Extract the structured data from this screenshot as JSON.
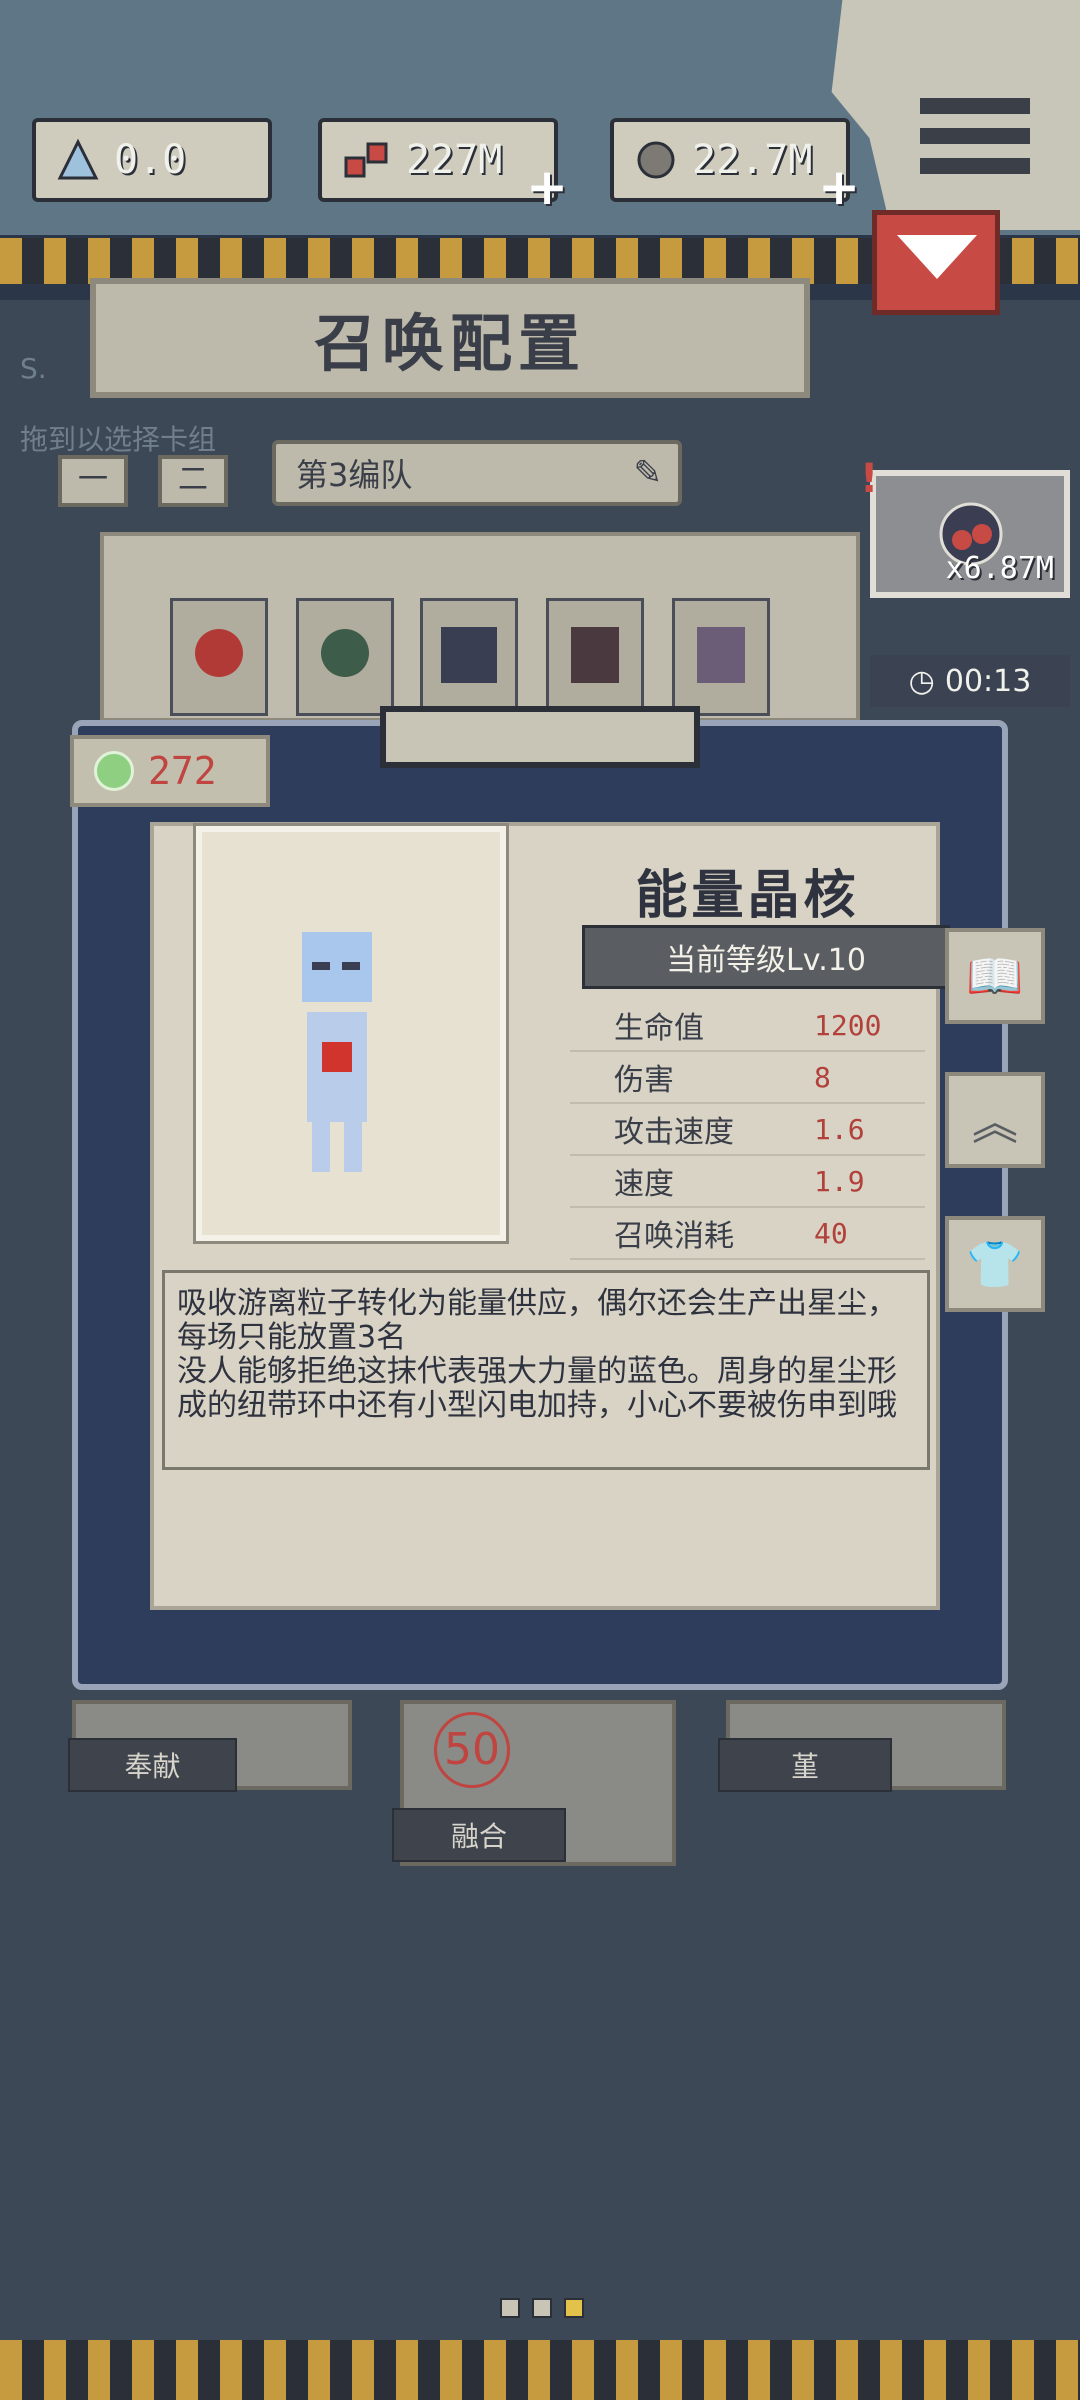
{
  "resources": [
    {
      "icon": "crystal-triangle-icon",
      "value": "0.0",
      "plus": ""
    },
    {
      "icon": "gem-cluster-icon",
      "value": "227M",
      "plus": "+"
    },
    {
      "icon": "planet-icon",
      "value": "22.7M",
      "plus": "+"
    }
  ],
  "header": {
    "title": "召唤配置",
    "hint_left": "S.",
    "hint_line": "拖到以选择卡组",
    "minus_label": "一",
    "equals_label": "二",
    "team_name": "第3编队"
  },
  "potion": {
    "count": "x6.87M",
    "timer": "00:13"
  },
  "energy": {
    "value": "272"
  },
  "card": {
    "name": "能量晶核",
    "level": "当前等级Lv.10",
    "stats": [
      {
        "label": "生命值",
        "value": "1200"
      },
      {
        "label": "伤害",
        "value": "8"
      },
      {
        "label": "攻击速度",
        "value": "1.6"
      },
      {
        "label": "速度",
        "value": "1.9"
      },
      {
        "label": "召唤消耗",
        "value": "40"
      }
    ],
    "description": "吸收游离粒子转化为能量供应，偶尔还会生产出星尘，每场只能放置3名\n没人能够拒绝这抹代表强大力量的蓝色。周身的星尘形成的纽带环中还有小型闪电加持，小心不要被伤申到哦"
  },
  "side_buttons": [
    "book-icon",
    "upgrade-chevron-icon",
    "shirt-icon"
  ],
  "bottom": {
    "left_label": "奉献",
    "middle_label": "融合",
    "middle_badge": "50",
    "right_label": "堇"
  },
  "colors": {
    "accent_red": "#c0443f",
    "panel_blue": "#2e3d5c",
    "paper": "#d8d3c4"
  }
}
